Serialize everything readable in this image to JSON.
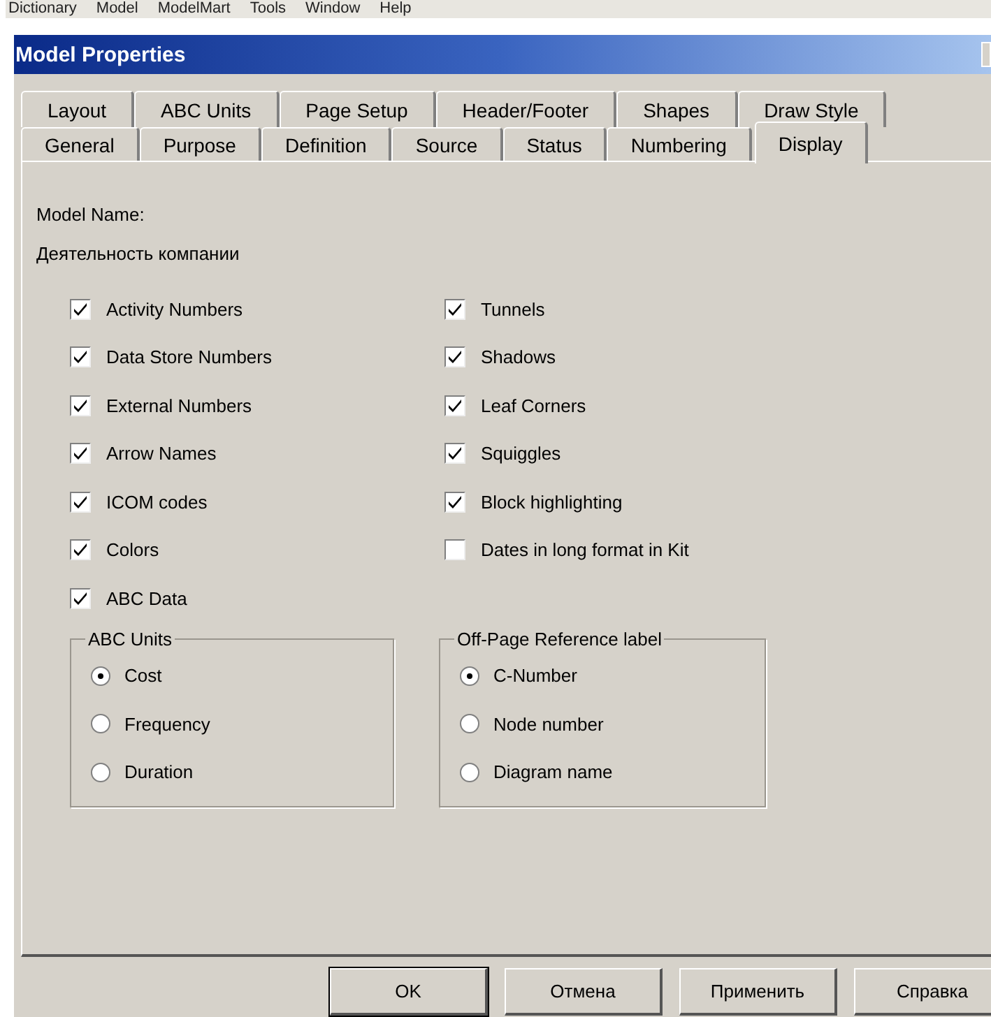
{
  "menu_bar": {
    "items": [
      "Dictionary",
      "Model",
      "ModelMart",
      "Tools",
      "Window",
      "Help"
    ]
  },
  "window": {
    "title": "Model Properties"
  },
  "tabs": [
    [
      {
        "label": "Layout",
        "selected": false
      },
      {
        "label": "ABC Units",
        "selected": false
      },
      {
        "label": "Page Setup",
        "selected": false
      },
      {
        "label": "Header/Footer",
        "selected": false
      },
      {
        "label": "Shapes",
        "selected": false
      },
      {
        "label": "Draw Style",
        "selected": false
      }
    ],
    [
      {
        "label": "General",
        "selected": false
      },
      {
        "label": "Purpose",
        "selected": false
      },
      {
        "label": "Definition",
        "selected": false
      },
      {
        "label": "Source",
        "selected": false
      },
      {
        "label": "Status",
        "selected": false
      },
      {
        "label": "Numbering",
        "selected": false
      },
      {
        "label": "Display",
        "selected": true
      }
    ]
  ],
  "model_name": {
    "label": "Model Name:",
    "value": "Деятельность компании"
  },
  "checkbox_columns": [
    [
      {
        "label": "Activity Numbers",
        "checked": true
      },
      {
        "label": "Data Store Numbers",
        "checked": true
      },
      {
        "label": "External Numbers",
        "checked": true
      },
      {
        "label": "Arrow Names",
        "checked": true
      },
      {
        "label": "ICOM codes",
        "checked": true
      },
      {
        "label": "Colors",
        "checked": true
      },
      {
        "label": "ABC Data",
        "checked": true
      }
    ],
    [
      {
        "label": "Tunnels",
        "checked": true
      },
      {
        "label": "Shadows",
        "checked": true
      },
      {
        "label": "Leaf Corners",
        "checked": true
      },
      {
        "label": "Squiggles",
        "checked": true
      },
      {
        "label": "Block highlighting",
        "checked": true
      },
      {
        "label": "Dates in long format in Kit",
        "checked": false
      }
    ]
  ],
  "groups": [
    {
      "title": "ABC Units",
      "options": [
        {
          "label": "Cost",
          "selected": true
        },
        {
          "label": "Frequency",
          "selected": false
        },
        {
          "label": "Duration",
          "selected": false
        }
      ]
    },
    {
      "title": "Off-Page Reference label",
      "options": [
        {
          "label": "C-Number",
          "selected": true
        },
        {
          "label": "Node number",
          "selected": false
        },
        {
          "label": "Diagram name",
          "selected": false
        }
      ]
    }
  ],
  "buttons": [
    {
      "label": "OK",
      "default": true
    },
    {
      "label": "Отмена",
      "default": false
    },
    {
      "label": "Применить",
      "default": false
    },
    {
      "label": "Справка",
      "default": false
    }
  ]
}
